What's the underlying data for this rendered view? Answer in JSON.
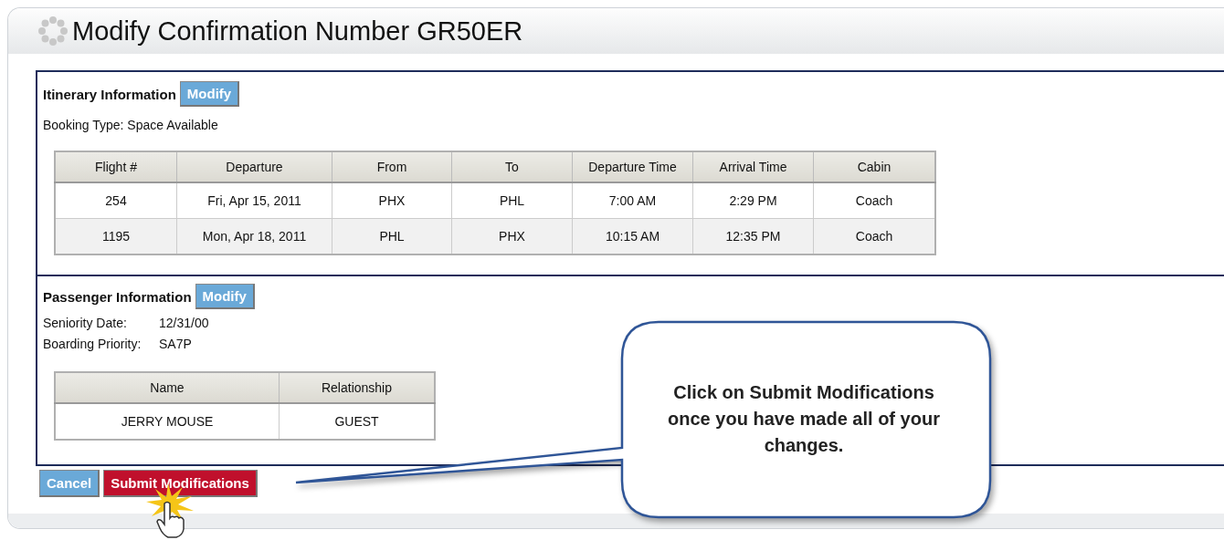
{
  "page_title": "Modify Confirmation Number GR50ER",
  "itinerary": {
    "heading": "Itinerary Information",
    "modify_button": "Modify",
    "booking_type": "Booking Type: Space Available",
    "table": {
      "columns": [
        "Flight #",
        "Departure",
        "From",
        "To",
        "Departure Time",
        "Arrival Time",
        "Cabin"
      ],
      "rows": [
        [
          "254",
          "Fri, Apr 15, 2011",
          "PHX",
          "PHL",
          "7:00 AM",
          "2:29 PM",
          "Coach"
        ],
        [
          "1195",
          "Mon, Apr 18, 2011",
          "PHL",
          "PHX",
          "10:15 AM",
          "12:35 PM",
          "Coach"
        ]
      ]
    }
  },
  "passenger": {
    "heading": "Passenger Information",
    "modify_button": "Modify",
    "fields": [
      {
        "label": "Seniority Date:",
        "value": "12/31/00"
      },
      {
        "label": "Boarding Priority:",
        "value": "SA7P"
      }
    ],
    "table": {
      "columns": [
        "Name",
        "Relationship"
      ],
      "rows": [
        [
          "JERRY MOUSE",
          "GUEST"
        ]
      ]
    }
  },
  "buttons": [
    {
      "label": "Cancel",
      "kind": "secondary"
    },
    {
      "label": "Submit Modifications",
      "kind": "primary"
    }
  ],
  "callout": {
    "text": "Click on Submit Modifications once you have made all of your changes."
  }
}
